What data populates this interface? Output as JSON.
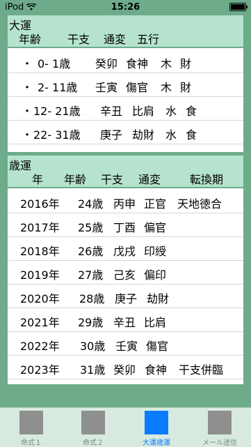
{
  "status": {
    "carrier": "iPod",
    "time": "15:26"
  },
  "taiun": {
    "title": "大運",
    "headers": [
      "年齢",
      "干支",
      "通変",
      "五行"
    ],
    "rows": [
      {
        "bullet": "・",
        "age": "0- 1歳",
        "kanshi": "癸卯",
        "tsuhen": "食神",
        "gogyo1": "木",
        "gogyo2": "財"
      },
      {
        "bullet": "・",
        "age": "2- 11歳",
        "kanshi": "壬寅",
        "tsuhen": "傷官",
        "gogyo1": "木",
        "gogyo2": "財"
      },
      {
        "bullet": "・",
        "age": "12- 21歳",
        "kanshi": "辛丑",
        "tsuhen": "比肩",
        "gogyo1": "水",
        "gogyo2": "食"
      },
      {
        "bullet": "・",
        "age": "22- 31歳",
        "kanshi": "庚子",
        "tsuhen": "劫財",
        "gogyo1": "水",
        "gogyo2": "食"
      }
    ]
  },
  "saiun": {
    "title": "歳運",
    "headers": [
      "年",
      "年齢",
      "干支",
      "通変",
      "転換期"
    ],
    "rows": [
      {
        "year": "2016年",
        "age": "24歳",
        "kanshi": "丙申",
        "tsuhen": "正官",
        "note": "天地徳合"
      },
      {
        "year": "2017年",
        "age": "25歳",
        "kanshi": "丁酉",
        "tsuhen": "偏官",
        "note": ""
      },
      {
        "year": "2018年",
        "age": "26歳",
        "kanshi": "戊戌",
        "tsuhen": "印綬",
        "note": ""
      },
      {
        "year": "2019年",
        "age": "27歳",
        "kanshi": "己亥",
        "tsuhen": "偏印",
        "note": ""
      },
      {
        "year": "2020年",
        "age": "28歳",
        "kanshi": "庚子",
        "tsuhen": "劫財",
        "note": ""
      },
      {
        "year": "2021年",
        "age": "29歳",
        "kanshi": "辛丑",
        "tsuhen": "比肩",
        "note": ""
      },
      {
        "year": "2022年",
        "age": "30歳",
        "kanshi": "壬寅",
        "tsuhen": "傷官",
        "note": ""
      },
      {
        "year": "2023年",
        "age": "31歳",
        "kanshi": "癸卯",
        "tsuhen": "食神",
        "note": "干支併臨"
      }
    ]
  },
  "tabs": [
    {
      "label": "命式１",
      "icon": "square-icon",
      "active": false
    },
    {
      "label": "命式２",
      "icon": "square-icon",
      "active": false
    },
    {
      "label": "大運歳運",
      "icon": "square-icon",
      "active": true
    },
    {
      "label": "メール送信",
      "icon": "square-icon",
      "active": false
    }
  ]
}
